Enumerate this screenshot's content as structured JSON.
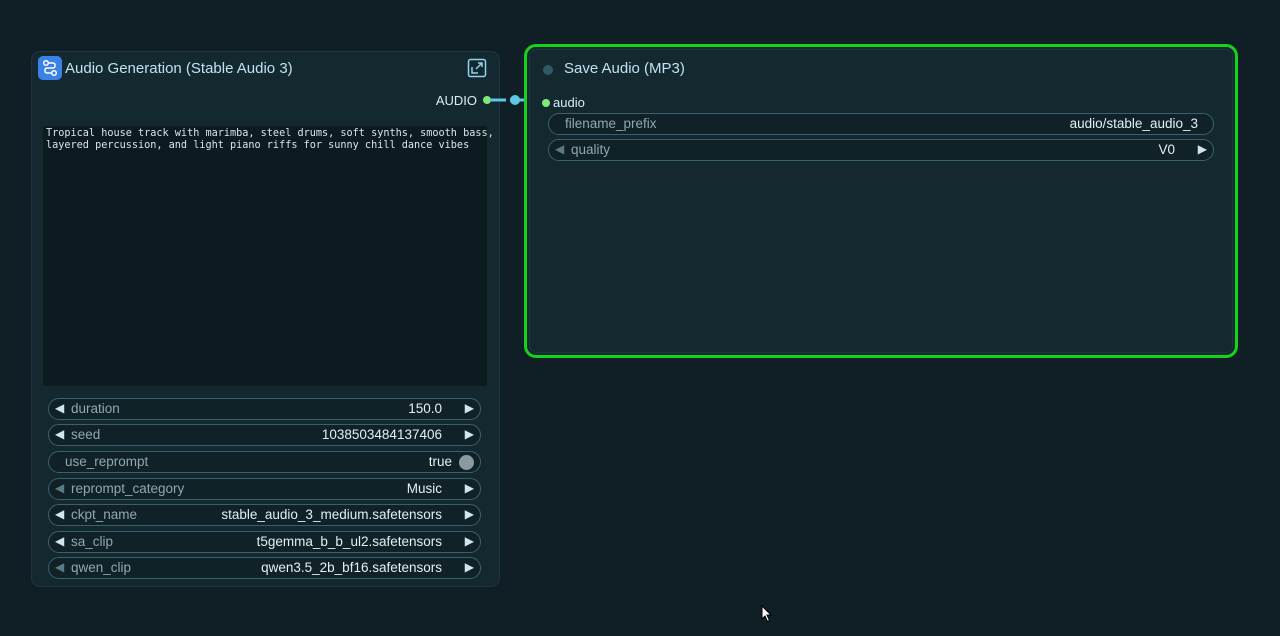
{
  "nodes": {
    "audio_gen": {
      "title": "Audio Generation (Stable Audio 3)",
      "output_label": "AUDIO",
      "prompt": "Tropical house track with marimba, steel drums, soft synths, smooth bass,\nlayered percussion, and light piano riffs for sunny chill dance vibes",
      "widgets": [
        {
          "label": "duration",
          "value": "150.0"
        },
        {
          "label": "seed",
          "value": "1038503484137406"
        },
        {
          "label": "use_reprompt",
          "value": "true"
        },
        {
          "label": "reprompt_category",
          "value": "Music"
        },
        {
          "label": "ckpt_name",
          "value": "stable_audio_3_medium.safetensors"
        },
        {
          "label": "sa_clip",
          "value": "t5gemma_b_b_ul2.safetensors"
        },
        {
          "label": "qwen_clip",
          "value": "qwen3.5_2b_bf16.safetensors"
        }
      ]
    },
    "save_audio": {
      "title": "Save Audio (MP3)",
      "input_label": "audio",
      "widgets": [
        {
          "label": "filename_prefix",
          "value": "audio/stable_audio_3"
        },
        {
          "label": "quality",
          "value": "V0"
        }
      ]
    }
  },
  "colors": {
    "background": "#0f1f25",
    "node_bg": "#142830",
    "selected_outline": "#16d21b",
    "port_audio": "#7fea78",
    "link": "#5bc8e8"
  },
  "icons": [
    "workflow-icon",
    "expand-icon",
    "arrow-left-icon",
    "arrow-right-icon",
    "toggle-icon",
    "cursor-icon"
  ]
}
